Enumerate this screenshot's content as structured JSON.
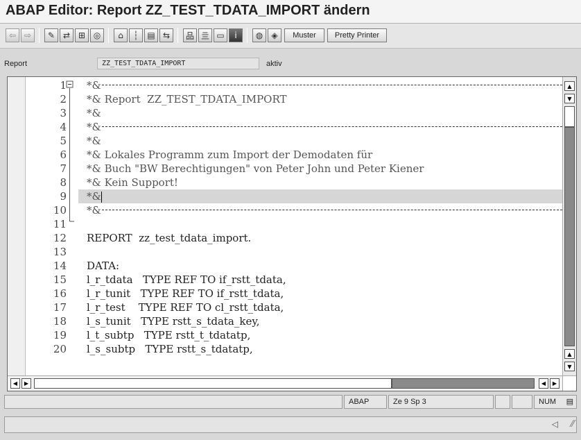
{
  "window": {
    "title": "ABAP Editor: Report ZZ_TEST_TDATA_IMPORT ändern"
  },
  "toolbar": {
    "back_icon": "arrow-left-icon",
    "forward_icon": "arrow-right-icon",
    "muster_label": "Muster",
    "pretty_printer_label": "Pretty Printer"
  },
  "report": {
    "label": "Report",
    "name": "ZZ_TEST_TDATA_IMPORT",
    "status": "aktiv"
  },
  "editor": {
    "lines": [
      {
        "no": "1",
        "text": "*&",
        "kind": "dashline"
      },
      {
        "no": "2",
        "text": "*& Report  ZZ_TEST_TDATA_IMPORT",
        "kind": "comment"
      },
      {
        "no": "3",
        "text": "*&",
        "kind": "comment"
      },
      {
        "no": "4",
        "text": "*&",
        "kind": "dashline"
      },
      {
        "no": "5",
        "text": "*&",
        "kind": "comment"
      },
      {
        "no": "6",
        "text": "*& Lokales Programm zum Import der Demodaten für",
        "kind": "comment"
      },
      {
        "no": "7",
        "text": "*& Buch \"BW Berechtigungen\" von Peter John und Peter Kiener",
        "kind": "comment"
      },
      {
        "no": "8",
        "text": "*& Kein Support!",
        "kind": "comment"
      },
      {
        "no": "9",
        "text": "*&",
        "kind": "current"
      },
      {
        "no": "10",
        "text": "*&",
        "kind": "dashline"
      },
      {
        "no": "11",
        "text": "",
        "kind": "code"
      },
      {
        "no": "12",
        "text": "REPORT  zz_test_tdata_import.",
        "kind": "code"
      },
      {
        "no": "13",
        "text": "",
        "kind": "code"
      },
      {
        "no": "14",
        "text": "DATA:",
        "kind": "code"
      },
      {
        "no": "15",
        "text": "l_r_tdata   TYPE REF TO if_rstt_tdata,",
        "kind": "code"
      },
      {
        "no": "16",
        "text": "l_r_tunit   TYPE REF TO if_rstt_tdata,",
        "kind": "code"
      },
      {
        "no": "17",
        "text": "l_r_test    TYPE REF TO cl_rstt_tdata,",
        "kind": "code"
      },
      {
        "no": "18",
        "text": "l_s_tunit   TYPE rstt_s_tdata_key,",
        "kind": "code"
      },
      {
        "no": "19",
        "text": "l_t_subtp   TYPE rstt_t_tdatatp,",
        "kind": "code"
      },
      {
        "no": "20",
        "text": "l_s_subtp   TYPE rstt_s_tdatatp,",
        "kind": "code"
      }
    ]
  },
  "statusbar": {
    "language": "ABAP",
    "cursor": "Ze  9 Sp  3",
    "numlock": "NUM"
  },
  "colors": {
    "highlight": "#d6d6d6",
    "background": "#d8d8d8"
  }
}
